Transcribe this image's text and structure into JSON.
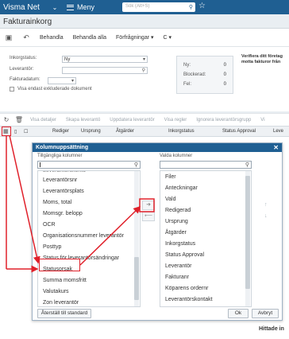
{
  "topbar": {
    "brand": "Visma Net",
    "chevron": "⌄",
    "menu_label": "Meny",
    "search_placeholder": "Sök (Alt+S)"
  },
  "page": {
    "title": "Fakturainkorg"
  },
  "toolbar": {
    "action1": "Behandla",
    "action2": "Behandla alla",
    "dropdown1": "Förfrågningar",
    "dropdown2": "C"
  },
  "filters": {
    "status_label": "Inkorgstatus:",
    "status_value": "Ny",
    "supplier_label": "Leverantör:",
    "invoice_date_label": "Fakturadatum:",
    "excluded_label": "Visa endast exkluderade dokument"
  },
  "stats": {
    "new_label": "Ny:",
    "new_value": "0",
    "blocked_label": "Blockerad:",
    "blocked_value": "0",
    "error_label": "Fel:",
    "error_value": "0"
  },
  "verify_text": "Verifiera ditt företag motta fakturor från",
  "grid_toolbar": {
    "items": [
      "Visa detaljer",
      "Skapa leverantö",
      "Uppdatera leverantör",
      "Visa regler",
      "Ignorera leverantörsgrupp",
      "Vi"
    ]
  },
  "grid_header": {
    "columns": [
      "Rediger",
      "Ursprung",
      "Åtgärder",
      "Inkorgstatus",
      "Status Approval",
      "Leve"
    ]
  },
  "dialog": {
    "title": "Kolumnuppsättning",
    "available_label": "Tillgängliga kolumner",
    "selected_label": "Valda kolumner",
    "available_items": [
      "Leverantörsnr",
      "Leverantörsplats",
      "Moms, total",
      "Momsgr. belopp",
      "OCR",
      "Organisationsnummer leverantör",
      "Posttyp",
      "Status för leverantörsändringar",
      "Statusorsak",
      "Summa momsfritt",
      "Valutakurs",
      "Zon leverantör"
    ],
    "selected_items": [
      "Filer",
      "Anteckningar",
      "Vald",
      "Redigerad",
      "Ursprung",
      "Åtgärder",
      "Inkorgstatus",
      "Status Approval",
      "Leverantör",
      "Fakturanr",
      "Köparens ordernr",
      "Leverantörskontakt"
    ],
    "reset_label": "Återställ till standard",
    "ok_label": "Ok",
    "cancel_label": "Avbryt"
  },
  "hidden_text": "Hittade in"
}
